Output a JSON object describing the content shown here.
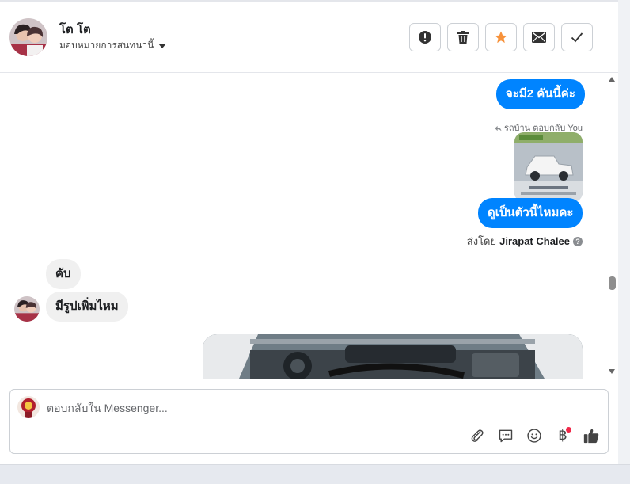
{
  "header": {
    "contact_name": "โต โต",
    "assign_label": "มอบหมายการสนทนานี้"
  },
  "actions": [
    {
      "name": "spam-button",
      "icon": "alert-icon"
    },
    {
      "name": "delete-button",
      "icon": "trash-icon"
    },
    {
      "name": "follow-up-button",
      "icon": "star-icon",
      "color": "#f7923b"
    },
    {
      "name": "mark-unread-button",
      "icon": "envelope-icon"
    },
    {
      "name": "done-button",
      "icon": "check-icon"
    }
  ],
  "messages": {
    "out_1": "จะมี2 คันนี้ค่ะ",
    "reply_note": "รถบ้าน ตอบกลับ You",
    "out_2": "ดูเป็นตัวนี้ไหมคะ",
    "sent_by_prefix": "ส่งโดย",
    "sent_by_name": "Jirapat Chalee",
    "in_1": "คับ",
    "in_2": "มีรูปเพิ่มไหม"
  },
  "composer": {
    "placeholder": "ตอบกลับใน Messenger..."
  },
  "colors": {
    "accent": "#0084ff",
    "star": "#f7923b",
    "notification": "#f02849"
  }
}
